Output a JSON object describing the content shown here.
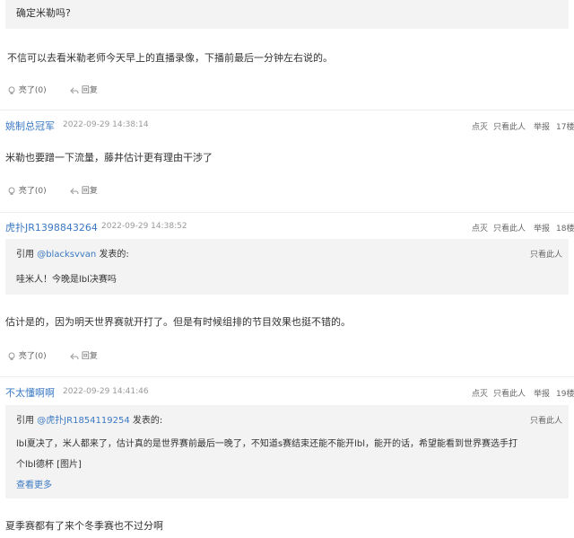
{
  "post1": {
    "quote_text": "确定米勒吗?",
    "body": "不信可以去看米勒老师今天早上的直播录像，下播前最后一分钟左右说的。",
    "like_label": "亮了",
    "like_count": "(0)",
    "reply_label": "回复"
  },
  "post2": {
    "username": "姚制总冠军",
    "time": "2022-09-29 14:38:14",
    "action_collapse": "点灭",
    "action_only": "只看此人",
    "action_report": "举报",
    "floor": "17楼",
    "body": "米勒也要蹭一下流量，藤井估计更有理由干涉了",
    "like_label": "亮了",
    "like_count": "(0)",
    "reply_label": "回复"
  },
  "post3": {
    "username": "虎扑JR1398843264",
    "time": "2022-09-29 14:38:52",
    "action_collapse": "点灭",
    "action_only": "只看此人",
    "action_report": "举报",
    "floor": "18楼",
    "quote_prefix": "引用",
    "quote_user": "@blacksvvan",
    "quote_suffix": "发表的:",
    "quote_only": "只看此人",
    "quote_text": "哇米人！今晚是lbl决赛吗",
    "body": "估计是的，因为明天世界赛就开打了。但是有时候组排的节目效果也挺不错的。",
    "like_label": "亮了",
    "like_count": "(0)",
    "reply_label": "回复"
  },
  "post4": {
    "username": "不太懂啊啊",
    "time": "2022-09-29 14:41:46",
    "action_collapse": "点灭",
    "action_only": "只看此人",
    "action_report": "举报",
    "floor": "19楼",
    "quote_prefix": "引用",
    "quote_user": "@虎扑JR1854119254",
    "quote_suffix": "发表的:",
    "quote_only": "只看此人",
    "quote_line1": "lbl夏决了，米人都来了，估计真的是世界赛前最后一晚了，不知道s赛结束还能不能开lbl，能开的话，希望能看到世界赛选手打",
    "quote_line2": "个lbl德杯 [图片]",
    "see_more": "查看更多",
    "body": "夏季赛都有了来个冬季赛也不过分啊"
  }
}
